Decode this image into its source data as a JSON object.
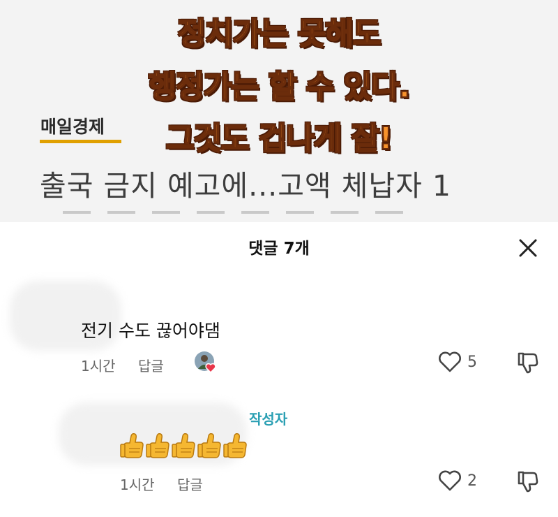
{
  "video": {
    "caption_lines": [
      "정치가는 못해도",
      "행정가는 할 수 있다.",
      "그것도 겁나게 잘!"
    ],
    "source": "매일경제",
    "headline": "출국 금지 예고에...고액 체납자 1"
  },
  "comments_sheet": {
    "title": "댓글 7개",
    "close_icon": "close-icon",
    "comments": [
      {
        "text": "전기 수도 끊어야댐",
        "time": "1시간",
        "reply_label": "답글",
        "likes": "5",
        "creator_hearted": true
      },
      {
        "badge": "작성자",
        "text": "👍👍👍👍👍",
        "time": "1시간",
        "reply_label": "답글",
        "likes": "2"
      }
    ]
  },
  "colors": {
    "caption_fill": "#f7922b",
    "caption_outline": "#4a1a05",
    "source_underline": "#e0a000",
    "author_badge": "#2a9fb3",
    "heart_red": "#e8364a"
  }
}
